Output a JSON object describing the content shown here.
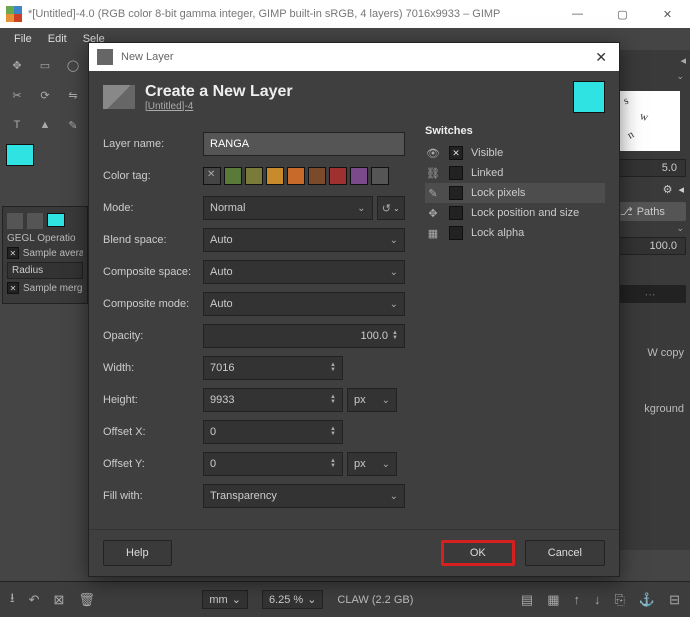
{
  "window": {
    "title": "*[Untitled]-4.0 (RGB color 8-bit gamma integer, GIMP built-in sRGB, 4 layers) 7016x9933 – GIMP"
  },
  "menu": {
    "file": "File",
    "edit": "Edit",
    "select": "Sele"
  },
  "gegl": {
    "title": "GEGL Operatio",
    "sample_avg": "Sample avera",
    "radius": "Radius",
    "sample_merged": "Sample merg"
  },
  "right": {
    "spin": "5.0",
    "paths": "Paths",
    "opac": "100.0",
    "wcopy": "W copy",
    "kground": "kground"
  },
  "bottom": {
    "unit": "mm",
    "val": "6.25 %",
    "mem": "CLAW (2.2 GB)"
  },
  "dialog": {
    "title": "New Layer",
    "heading": "Create a New Layer",
    "sub": "[Untitled]-4",
    "labels": {
      "layer_name": "Layer name:",
      "color_tag": "Color tag:",
      "mode": "Mode:",
      "blend_space": "Blend space:",
      "composite_space": "Composite space:",
      "composite_mode": "Composite mode:",
      "opacity": "Opacity:",
      "width": "Width:",
      "height": "Height:",
      "offset_x": "Offset X:",
      "offset_y": "Offset Y:",
      "fill_with": "Fill with:"
    },
    "values": {
      "layer_name": "RANGA",
      "mode": "Normal",
      "blend_space": "Auto",
      "composite_space": "Auto",
      "composite_mode": "Auto",
      "opacity": "100.0",
      "width": "7016",
      "height": "9933",
      "offset_x": "0",
      "offset_y": "0",
      "fill_with": "Transparency",
      "unit": "px"
    },
    "color_tags": [
      "#444",
      "#5a7a3a",
      "#7a7a3a",
      "#c88a2a",
      "#c86a2a",
      "#7a4a2a",
      "#a03030",
      "#7a4a8a",
      "#555"
    ],
    "switches": {
      "heading": "Switches",
      "visible": "Visible",
      "linked": "Linked",
      "lock_pixels": "Lock pixels",
      "lock_position": "Lock position and size",
      "lock_alpha": "Lock alpha"
    },
    "buttons": {
      "help": "Help",
      "ok": "OK",
      "cancel": "Cancel"
    }
  }
}
